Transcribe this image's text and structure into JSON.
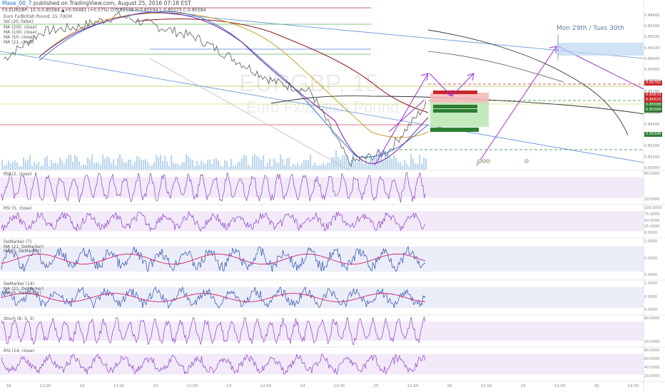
{
  "header": {
    "user": "Mase_00_7",
    "published": "published on TradingView.com, August 25, 2016 07:18 EST",
    "quote": "FX:EURGBP, 15  0:0.85584 ▲+0.00481 (+0.57%) O:0.85538 H:0.85594 L:0.85573 C:0.85584"
  },
  "main_legend": [
    "Euro Fx/British Pound, 15, FXCM",
    "Vol (20, false)",
    "MA (200, close)",
    "MA (100, close)",
    "MA (50, close)",
    "MA (21, close)"
  ],
  "watermark": {
    "symbol": "EURGBP, 15",
    "name": "Euro Fx/British Pound"
  },
  "annotation": "Mon 29th / Tues 30th",
  "price_axis": [
    "0.86400",
    "0.86300",
    "0.86200",
    "0.86100",
    "0.86000",
    "0.85900",
    "0.85800",
    "0.85700",
    "0.85600",
    "0.85500",
    "0.85400",
    "0.85300",
    "0.85200",
    "0.85100",
    "0.85000"
  ],
  "price_badges": [
    {
      "value": "0.85781",
      "color": "#c62828"
    },
    {
      "value": "0.85670",
      "color": "#c62828"
    },
    {
      "value": "0.85623",
      "color": "#c62828"
    },
    {
      "value": "0.85588",
      "color": "#2e7d32"
    },
    {
      "value": "0.85584",
      "color": "#2e7d32"
    },
    {
      "value": "0.85308",
      "color": "#2e7d32"
    }
  ],
  "x_axis": [
    "18",
    "12:00",
    "19",
    "12:00",
    "22",
    "12:00",
    "23",
    "12:00",
    "24",
    "12:00",
    "25",
    "12:00",
    "26",
    "12:00",
    "29",
    "12:00",
    "30",
    "12:00"
  ],
  "panels": [
    {
      "labels": [
        "RSI (2, close)"
      ],
      "ticks": [
        "80.0000",
        "20.0000"
      ]
    },
    {
      "labels": [
        "RSI (5, close)"
      ],
      "ticks": [
        "100.0000",
        "75.0000",
        "50.0000",
        "25.0000",
        "0.0000"
      ]
    },
    {
      "labels": [
        "DeMarker (7)",
        "MA (21, DeMarker)",
        "MA (5, DeMarker)"
      ],
      "ticks": [
        "1.0000",
        "0.5000",
        "0.0000"
      ]
    },
    {
      "labels": [
        "DeMarker (14)",
        "MA (21, DeMarker)",
        "MA (5, DeMarker)"
      ],
      "ticks": [
        "1.0000",
        "0.5000",
        "0.0000"
      ]
    },
    {
      "labels": [
        "Stoch (8, 3, 3)"
      ],
      "ticks": [
        "80.0000",
        "20.0000"
      ]
    },
    {
      "labels": [
        "RSI (14, close)"
      ],
      "ticks": [
        "80.0000",
        "60.0000",
        "40.0000",
        "20.0000"
      ]
    }
  ],
  "chart_data": {
    "type": "line",
    "title": "Euro Fx/British Pound, 15, FXCM",
    "ylim": [
      0.85,
      0.8645
    ],
    "x": [
      "18",
      "12:00",
      "19",
      "12:00",
      "22",
      "12:00",
      "23",
      "12:00",
      "24",
      "12:00",
      "25",
      "12:00"
    ],
    "series": [
      {
        "name": "Euro Fx/British Pound",
        "values": [
          0.86,
          0.8625,
          0.863,
          0.864,
          0.863,
          0.862,
          0.86,
          0.858,
          0.857,
          0.8505,
          0.8515,
          0.8558
        ]
      },
      {
        "name": "MA (200, close)",
        "values": [
          0.8635,
          0.8637,
          0.8638,
          0.8636,
          0.8632,
          0.8625,
          0.8612,
          0.8598,
          0.8585,
          0.8575,
          0.8566,
          0.8562
        ]
      },
      {
        "name": "MA (100, close)",
        "values": [
          0.861,
          0.8625,
          0.8632,
          0.863,
          0.8622,
          0.861,
          0.8595,
          0.8578,
          0.8562,
          0.8545,
          0.8535,
          0.8535
        ]
      },
      {
        "name": "MA (50, close)",
        "values": [
          0.8605,
          0.8626,
          0.8633,
          0.8628,
          0.8618,
          0.8605,
          0.8588,
          0.8575,
          0.8552,
          0.8525,
          0.852,
          0.854
        ]
      },
      {
        "name": "MA (21, close)",
        "values": [
          0.8602,
          0.8627,
          0.8635,
          0.863,
          0.8618,
          0.8603,
          0.8585,
          0.8574,
          0.854,
          0.851,
          0.8518,
          0.855
        ]
      }
    ],
    "levels": [
      0.85781,
      0.8567,
      0.85623,
      0.85588,
      0.85308
    ],
    "colors": {
      "price": "#6a6a6a",
      "ma200": "#8b1a1a",
      "ma100": "#c9a227",
      "ma50": "#3a78c9",
      "ma21": "#7b1fa2",
      "channel": "#5b8fd6",
      "projection": "#9b30d9"
    }
  }
}
